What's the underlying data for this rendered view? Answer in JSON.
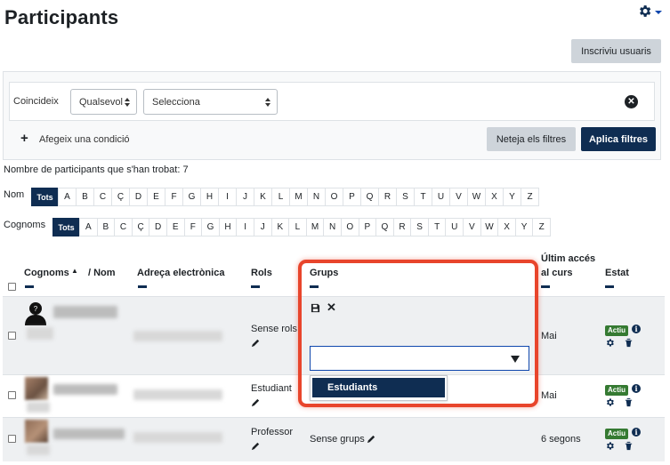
{
  "page": {
    "title": "Participants"
  },
  "header": {
    "enrol_button": "Inscriviu usuaris",
    "settings_icon": "gear-icon"
  },
  "filter": {
    "match_label": "Coincideix",
    "match_value": "Qualsevol",
    "type_value": "Selecciona",
    "add_condition": "Afegeix una condició",
    "clear_button": "Neteja els filtres",
    "apply_button": "Aplica filtres"
  },
  "count_text": "Nombre de participants que s'han trobat: 7",
  "initials": {
    "first_label": "Nom",
    "last_label": "Cognoms",
    "all_label": "Tots",
    "letters": [
      "A",
      "B",
      "C",
      "Ç",
      "D",
      "E",
      "F",
      "G",
      "H",
      "I",
      "J",
      "K",
      "L",
      "M",
      "N",
      "O",
      "P",
      "Q",
      "R",
      "S",
      "T",
      "U",
      "V",
      "W",
      "X",
      "Y",
      "Z"
    ]
  },
  "table": {
    "headers": {
      "surname": "Cognoms",
      "sort_indicator": "▲",
      "name": "/ Nom",
      "email": "Adreça electrònica",
      "roles": "Rols",
      "groups": "Grups",
      "last_access_1": "Últim accés",
      "last_access_2": "al curs",
      "status": "Estat"
    },
    "rows": [
      {
        "role": "Sense rols",
        "groups": "",
        "last_access": "Mai",
        "status": "Actiu"
      },
      {
        "role": "Estudiant",
        "groups": "",
        "last_access": "Mai",
        "status": "Actiu"
      },
      {
        "role": "Professor",
        "groups": "Sense grups",
        "last_access": "6 segons",
        "status": "Actiu"
      }
    ]
  },
  "group_editor": {
    "selected_option": "Estudiants"
  },
  "colors": {
    "primary": "#0f2d52",
    "active_badge": "#357a32",
    "highlight": "#e8452c"
  }
}
